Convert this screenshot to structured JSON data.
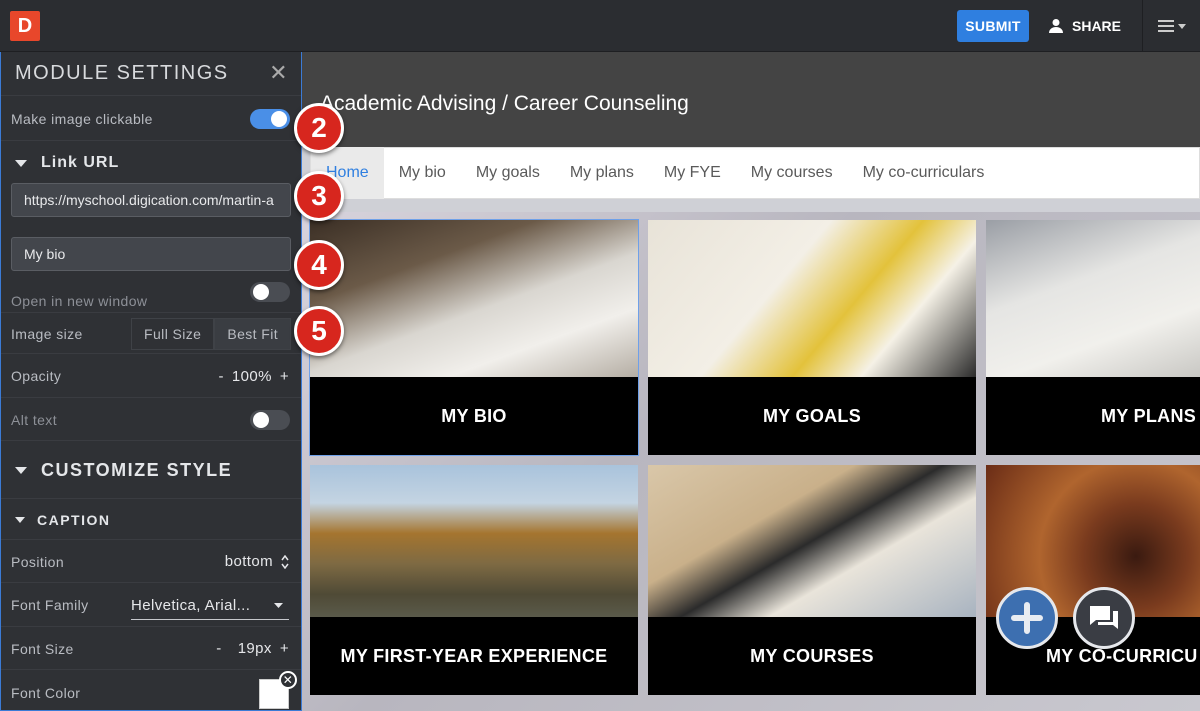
{
  "topbar": {
    "logo": "D",
    "submit_label": "SUBMIT",
    "share_label": "SHARE"
  },
  "sidebar": {
    "title": "MODULE SETTINGS",
    "make_clickable_label": "Make image clickable",
    "make_clickable_on": true,
    "link_url_heading": "Link URL",
    "url_value": "https://myschool.digication.com/martin-a",
    "link_text_value": "My bio",
    "new_window_label": "Open in new window",
    "new_window_on": false,
    "image_size_label": "Image size",
    "image_size_options": [
      "Full Size",
      "Best Fit"
    ],
    "image_size_selected": "Best Fit",
    "opacity_label": "Opacity",
    "opacity_minus": "-",
    "opacity_value": "100%",
    "opacity_plus": "+",
    "alt_text_label": "Alt text",
    "alt_text_on": false,
    "customize_heading": "CUSTOMIZE STYLE",
    "caption_heading": "CAPTION",
    "position_label": "Position",
    "position_value": "bottom",
    "font_family_label": "Font Family",
    "font_family_value": "Helvetica, Arial...",
    "font_size_label": "Font Size",
    "font_size_minus": "-",
    "font_size_value": "19px",
    "font_size_plus": "+",
    "font_color_label": "Font Color",
    "font_color_value": "#ffffff"
  },
  "main": {
    "site_title": "Academic Advising / Career Counseling",
    "nav": [
      "Home",
      "My bio",
      "My goals",
      "My plans",
      "My FYE",
      "My courses",
      "My co-curriculars"
    ],
    "tiles": [
      {
        "caption": "MY BIO"
      },
      {
        "caption": "MY GOALS"
      },
      {
        "caption": "MY PLANS"
      },
      {
        "caption": "MY FIRST-YEAR EXPERIENCE"
      },
      {
        "caption": "MY COURSES"
      },
      {
        "caption": "MY CO-CURRICU"
      }
    ]
  },
  "callouts": [
    "2",
    "3",
    "4",
    "5"
  ],
  "colors": {
    "accent": "#2f7fe0",
    "toggle_on": "#4a8fe7",
    "callout": "#d7261e",
    "logo": "#e8472b"
  }
}
